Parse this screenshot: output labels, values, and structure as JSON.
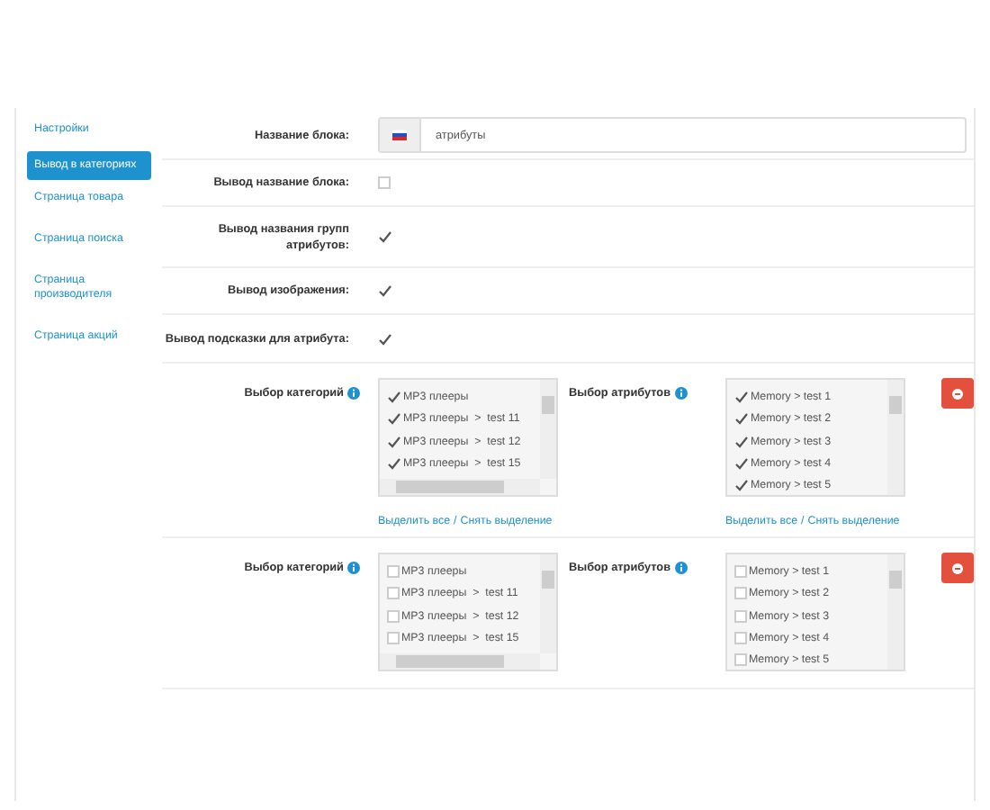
{
  "sidebar": {
    "items": [
      {
        "label": "Настройки",
        "selected": false
      },
      {
        "label": "Вывод в категориях",
        "selected": true
      },
      {
        "label": "Страница товара",
        "selected": false
      },
      {
        "label": "Страница поиска",
        "selected": false
      },
      {
        "label": "Страница производителя",
        "selected": false
      },
      {
        "label": "Страница акций",
        "selected": false
      }
    ]
  },
  "fields": [
    {
      "kind": "text",
      "label": "Название блока:",
      "value": "атрибуты"
    },
    {
      "kind": "checkbox",
      "label": "Вывод название блока:",
      "checked": false
    },
    {
      "kind": "checkbox",
      "label": "Вывод названия групп атрибутов:",
      "checked": true
    },
    {
      "kind": "checkbox",
      "label": "Вывод изображения:",
      "checked": true
    },
    {
      "kind": "checkbox",
      "label": "Вывод подсказки для атрибута:",
      "checked": true
    }
  ],
  "blocks": [
    {
      "categories": {
        "label": "Выбор категорий",
        "items": [
          {
            "label": "MP3 плееры",
            "checked": true
          },
          {
            "label": "MP3 плееры  >  test 11",
            "checked": true
          },
          {
            "label": "MP3 плееры  >  test 12",
            "checked": true
          },
          {
            "label": "MP3 плееры  >  test 15",
            "checked": true
          }
        ],
        "links": {
          "select_all": "Выделить все",
          "separator": "/",
          "deselect": "Снять выделение"
        }
      },
      "attributes": {
        "label": "Выбор атрибутов",
        "items": [
          {
            "label": "Memory > test 1",
            "checked": true
          },
          {
            "label": "Memory > test 2",
            "checked": true
          },
          {
            "label": "Memory > test 3",
            "checked": true
          },
          {
            "label": "Memory > test 4",
            "checked": true
          },
          {
            "label": "Memory > test 5",
            "checked": true
          }
        ],
        "links": {
          "select_all": "Выделить все",
          "separator": "/",
          "deselect": "Снять выделение"
        }
      }
    },
    {
      "categories": {
        "label": "Выбор категорий",
        "items": [
          {
            "label": "MP3 плееры",
            "checked": false
          },
          {
            "label": "MP3 плееры  >  test 11",
            "checked": false
          },
          {
            "label": "MP3 плееры  >  test 12",
            "checked": false
          },
          {
            "label": "MP3 плееры  >  test 15",
            "checked": false
          }
        ]
      },
      "attributes": {
        "label": "Выбор атрибутов",
        "items": [
          {
            "label": "Memory > test 1",
            "checked": false
          },
          {
            "label": "Memory > test 2",
            "checked": false
          },
          {
            "label": "Memory > test 3",
            "checked": false
          },
          {
            "label": "Memory > test 4",
            "checked": false
          },
          {
            "label": "Memory > test 5",
            "checked": false
          }
        ]
      }
    }
  ]
}
